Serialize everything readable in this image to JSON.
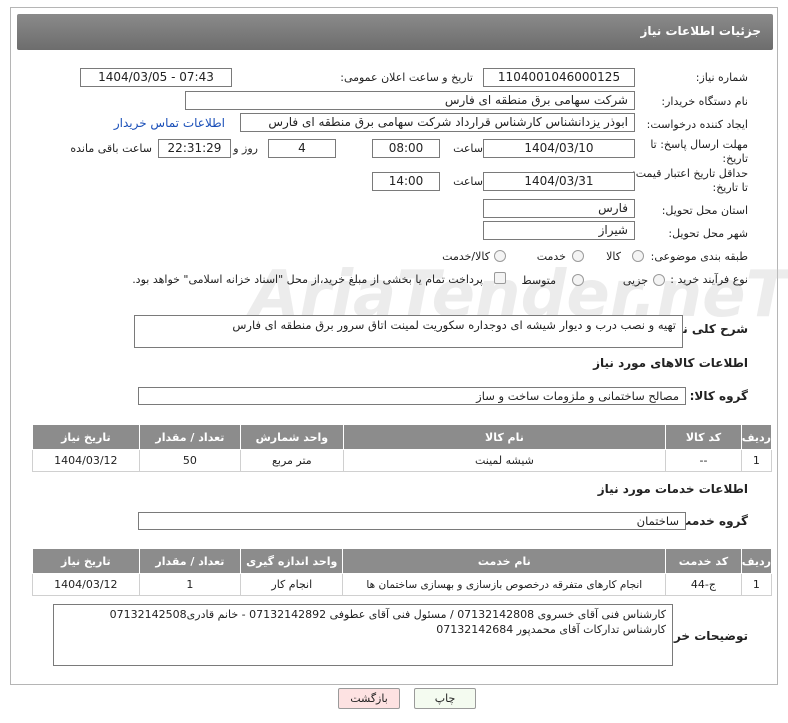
{
  "header": {
    "title": "جزئیات اطلاعات نیاز"
  },
  "form": {
    "need_number_label": "شماره نیاز:",
    "need_number": "1104001046000125",
    "announce_label": "تاریخ و ساعت اعلان عمومی:",
    "announce_value": "1404/03/05 - 07:43",
    "buyer_org_label": "نام دستگاه خریدار:",
    "buyer_org": "شرکت سهامی برق منطقه ای فارس",
    "creator_label": "ایجاد کننده درخواست:",
    "creator": "ابوذر  یزدانشناس کارشناس قرارداد شرکت سهامی برق منطقه ای فارس",
    "contact_link": "اطلاعات تماس خریدار",
    "reply_deadline_label_1": "مهلت ارسال پاسخ: تا",
    "reply_deadline_label_2": "تاریخ:",
    "reply_date": "1404/03/10",
    "time_label": "ساعت",
    "reply_time": "08:00",
    "days_value": "4",
    "days_label": "روز و",
    "remaining_time": "22:31:29",
    "remaining_label": "ساعت باقی مانده",
    "price_validity_label_1": "حداقل تاریخ اعتبار قیمت:",
    "price_validity_label_2": "تا تاریخ:",
    "validity_date": "1404/03/31",
    "validity_time": "14:00",
    "province_label": "استان محل تحویل:",
    "province": "فارس",
    "city_label": "شهر محل تحویل:",
    "city": "شیراز",
    "category_label": "طبقه بندی موضوعی:",
    "category_options": [
      "کالا",
      "خدمت",
      "کالا/خدمت"
    ],
    "process_label": "نوع فرآیند خرید :",
    "process_options": [
      "جزیی",
      "متوسط"
    ],
    "payment_note": "پرداخت تمام یا بخشی از مبلغ خرید،از محل \"اسناد خزانه اسلامی\" خواهد بود.",
    "description_label": "شرح کلی نیاز:",
    "description": "تهیه و نصب درب و دیوار شیشه ای دوجداره سکوریت لمینت اتاق سرور برق منطقه ای فارس"
  },
  "goods": {
    "section_title": "اطلاعات کالاهای مورد نیاز",
    "group_label": "گروه کالا:",
    "group_value": "مصالح ساختمانی و ملزومات ساخت و ساز",
    "columns": [
      "ردیف",
      "کد کالا",
      "نام کالا",
      "واحد شمارش",
      "تعداد / مقدار",
      "تاریخ نیاز"
    ],
    "rows": [
      [
        "1",
        "--",
        "شیشه لمینت",
        "متر مربع",
        "50",
        "1404/03/12"
      ]
    ]
  },
  "services": {
    "section_title": "اطلاعات خدمات مورد نیاز",
    "group_label": "گروه خدمت:",
    "group_value": "ساختمان",
    "columns": [
      "ردیف",
      "کد خدمت",
      "نام خدمت",
      "واحد اندازه گیری",
      "تعداد / مقدار",
      "تاریخ نیاز"
    ],
    "rows": [
      [
        "1",
        "ج-44",
        "انجام کارهای متفرقه درخصوص بازسازی و بهسازی ساختمان ها",
        "انجام کار",
        "1",
        "1404/03/12"
      ]
    ]
  },
  "buyer_notes": {
    "label": "توضیحات خریدار:",
    "line1": "کارشناس فنی آقای خسروی 07132142808 / مسئول فنی آقای عطوفی 07132142892 - خانم قادری07132142508",
    "line2": "کارشناس تدارکات آقای محمدپور 07132142684"
  },
  "buttons": {
    "print": "چاپ",
    "back": "بازگشت"
  },
  "watermark": "AriaTender.neT"
}
